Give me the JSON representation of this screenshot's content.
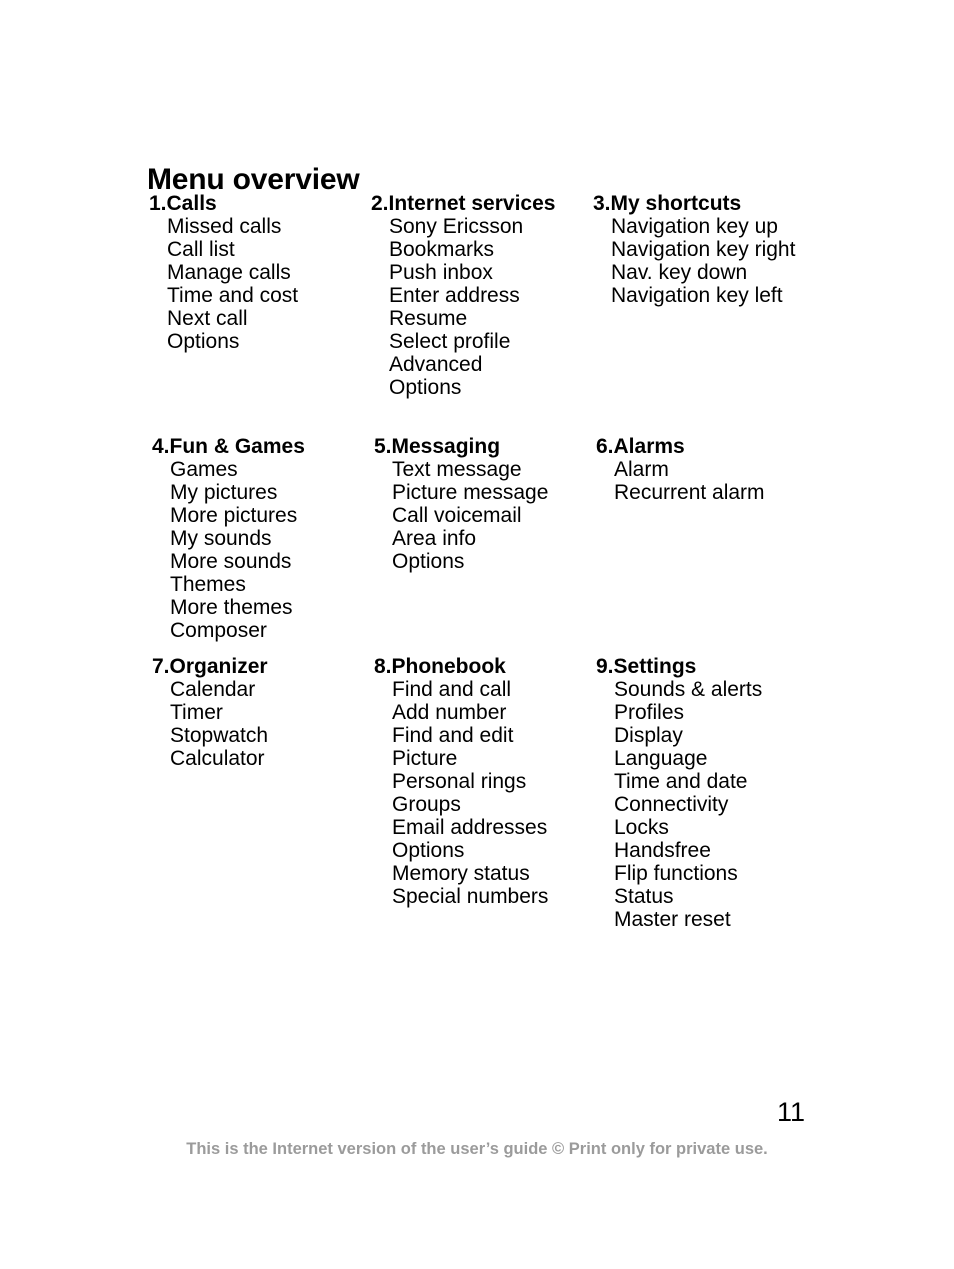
{
  "document": {
    "title": "Menu overview",
    "page_number": "11",
    "footer_note": "This is the Internet version of the user’s guide © Print only for private use."
  },
  "colors": {
    "text": "#000000",
    "footer_text": "#9b9b9b",
    "background": "#ffffff"
  },
  "menu": {
    "rows": [
      {
        "columns": [
          {
            "number": "1.",
            "heading": "Calls",
            "heading_full": "1.Calls",
            "items": [
              "Missed calls",
              "Call list",
              "Manage calls",
              "Time and cost",
              "Next call",
              "Options"
            ]
          },
          {
            "number": "2.",
            "heading": "Internet services",
            "heading_full": "2.Internet services",
            "items": [
              "Sony Ericsson",
              "Bookmarks",
              "Push inbox",
              "Enter address",
              "Resume",
              "Select profile",
              "Advanced",
              "Options"
            ]
          },
          {
            "number": "3.",
            "heading": "My shortcuts",
            "heading_full": "3.My shortcuts",
            "items": [
              "Navigation key up",
              "Navigation key right",
              "Nav. key down",
              "Navigation key left"
            ]
          }
        ]
      },
      {
        "columns": [
          {
            "number": "4.",
            "heading": "Fun & Games",
            "heading_full": "4.Fun & Games",
            "items": [
              "Games",
              "My pictures",
              "More pictures",
              "My sounds",
              "More sounds",
              "Themes",
              "More themes",
              "Composer"
            ]
          },
          {
            "number": "5.",
            "heading": "Messaging",
            "heading_full": "5.Messaging",
            "items": [
              "Text message",
              "Picture message",
              "Call voicemail",
              "Area info",
              "Options"
            ]
          },
          {
            "number": "6.",
            "heading": "Alarms",
            "heading_full": "6.Alarms",
            "items": [
              "Alarm",
              "Recurrent alarm"
            ]
          }
        ]
      },
      {
        "columns": [
          {
            "number": "7.",
            "heading": "Organizer",
            "heading_full": "7.Organizer",
            "items": [
              "Calendar",
              "Timer",
              "Stopwatch",
              "Calculator"
            ]
          },
          {
            "number": "8.",
            "heading": "Phonebook",
            "heading_full": "8.Phonebook",
            "items": [
              "Find and call",
              "Add number",
              "Find and edit",
              "Picture",
              "Personal rings",
              "Groups",
              "Email addresses",
              "Options",
              "Memory status",
              "Special numbers"
            ]
          },
          {
            "number": "9.",
            "heading": "Settings",
            "heading_full": "9.Settings",
            "items": [
              "Sounds & alerts",
              "Profiles",
              "Display",
              "Language",
              "Time and date",
              "Connectivity",
              "Locks",
              "Handsfree",
              "Flip functions",
              "Status",
              "Master reset"
            ]
          }
        ]
      }
    ]
  }
}
